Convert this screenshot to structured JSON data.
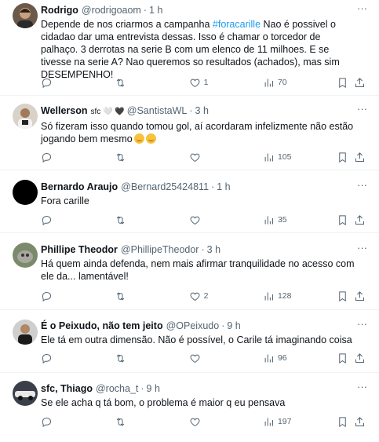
{
  "tweets": [
    {
      "name": "Rodrigo",
      "handle": "@rodrigoaom",
      "sep": "·",
      "time": "1 h",
      "text_pre": "Depende de nos criarmos a campanha ",
      "hashtag": "#foracarille",
      "text_post": " Nao é possivel o cidadao dar uma entrevista dessas. Isso é chamar o torcedor de palhaço. 3 derrotas na serie B com um elenco de 11 milhoes. E se tivesse na serie A? Nao queremos so resultados (achados), mas sim DESEMPENHO!",
      "replies": "",
      "retweets": "",
      "likes": "1",
      "views": "70"
    },
    {
      "name": "Wellerson",
      "name_badges": "sfc 🤍 🖤",
      "handle": "@SantistaWL",
      "sep": "·",
      "time": "3 h",
      "text": "Só fizeram isso quando tomou gol, aí acordaram infelizmente não estão jogando bem mesmo",
      "replies": "",
      "retweets": "",
      "likes": "",
      "views": "105"
    },
    {
      "name": "Bernardo Araujo",
      "handle": "@Bernard25424811",
      "sep": "·",
      "time": "1 h",
      "text": "Fora carille",
      "replies": "",
      "retweets": "",
      "likes": "",
      "views": "35"
    },
    {
      "name": "Phillipe Theodor",
      "handle": "@PhillipeTheodor",
      "sep": "·",
      "time": "3 h",
      "text": "Há quem ainda defenda, nem mais afirmar tranquilidade no acesso com ele da... lamentável!",
      "replies": "",
      "retweets": "",
      "likes": "2",
      "views": "128"
    },
    {
      "name": "É o Peixudo, não tem jeito",
      "handle": "@OPeixudo",
      "sep": "·",
      "time": "9 h",
      "text": "Ele tá em outra dimensão. Não é possível, o Carile tá imaginando coisa",
      "replies": "",
      "retweets": "",
      "likes": "",
      "views": "96"
    },
    {
      "name": "sfc, Thiago",
      "handle": "@rocha_t",
      "sep": "·",
      "time": "9 h",
      "text": "Se ele acha q tá bom, o problema é maior q eu pensava",
      "replies": "",
      "retweets": "",
      "likes": "",
      "views": "197"
    }
  ],
  "more_glyph": "···",
  "colors": {
    "text": "#0f1419",
    "secondary": "#536471",
    "link": "#1d9bf0",
    "divider": "#eff3f4"
  },
  "icons": [
    "reply-icon",
    "retweet-icon",
    "like-icon",
    "views-icon",
    "bookmark-icon",
    "share-icon",
    "more-icon"
  ]
}
